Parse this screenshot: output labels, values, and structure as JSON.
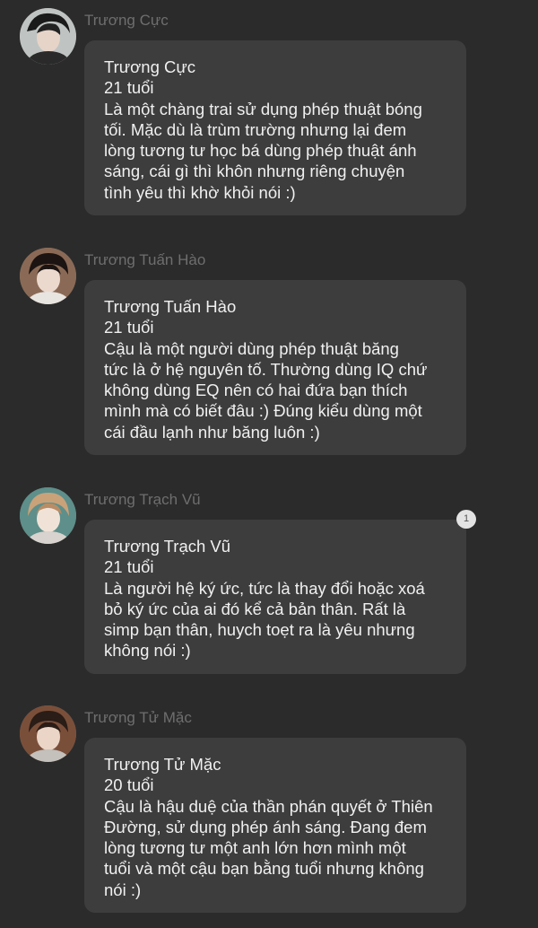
{
  "messages": [
    {
      "sender": "Trương Cực",
      "name": "Trương Cực",
      "age": "21 tuổi",
      "lines": [
        "Là một chàng trai sử dụng phép thuật bóng",
        "tối. Mặc dù là trùm trường nhưng lại đem",
        "lòng tương tư học bá dùng phép thuật ánh",
        "sáng, cái gì thì khôn nhưng riêng chuyện",
        "tình yêu thì khờ khỏi nói :)"
      ]
    },
    {
      "sender": "Trương Tuấn Hào",
      "name": "Trương Tuấn Hào",
      "age": "21 tuổi",
      "lines": [
        "Cậu là một người dùng phép thuật băng",
        "tức là ở hệ nguyên tố. Thường dùng IQ chứ",
        "không dùng EQ nên có hai đứa bạn thích",
        "mình mà có biết đâu :) Đúng kiểu dùng một",
        "cái đầu lạnh như băng luôn :)"
      ]
    },
    {
      "sender": "Trương Trạch Vũ",
      "name": "Trương Trạch Vũ",
      "age": "21 tuổi",
      "lines": [
        "Là người hệ ký ức, tức là thay đổi hoặc xoá",
        "bỏ ký ức của ai đó kể cả bản thân. Rất là",
        "simp bạn thân, huych toẹt ra là yêu nhưng",
        "không nói :)"
      ]
    },
    {
      "sender": "Trương Tử Mặc",
      "name": "Trương Tử Mặc",
      "age": "20 tuổi",
      "lines": [
        "Cậu là hậu duệ của thần phán quyết ở Thiên",
        "Đường, sử dụng phép ánh sáng. Đang đem",
        "lòng tương tư một anh lớn hơn mình một",
        "tuổi và một cậu bạn bằng tuổi nhưng không",
        "nói :)"
      ]
    }
  ],
  "reaction_badge": "1",
  "colors": {
    "background": "#2b2b2b",
    "bubble": "#3d3d3d",
    "sender_name": "#6e6e6e",
    "text": "#f0f0f0"
  }
}
